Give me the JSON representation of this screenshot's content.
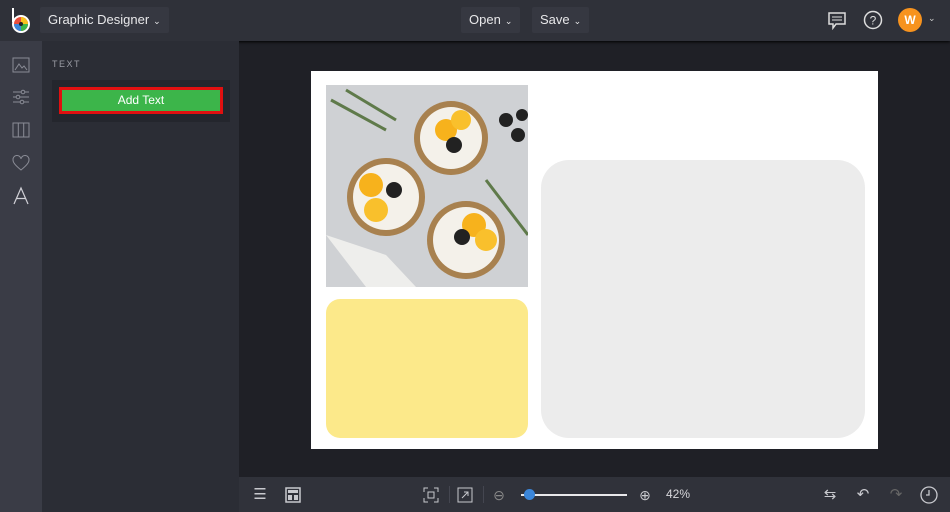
{
  "header": {
    "app_menu_label": "Graphic Designer",
    "open_label": "Open",
    "save_label": "Save",
    "avatar_initial": "W",
    "avatar_color": "#f7931e"
  },
  "rail": {
    "icons": [
      "image-icon",
      "sliders-icon",
      "columns-icon",
      "heart-icon",
      "text-icon"
    ]
  },
  "panel": {
    "title": "TEXT",
    "add_text_label": "Add Text",
    "accent": "#3cb54a"
  },
  "canvas": {
    "yellow_color": "#fce98a",
    "gray_color": "#ececec"
  },
  "bottom": {
    "zoom_level": "42%",
    "zoom_fraction": 0.05
  }
}
